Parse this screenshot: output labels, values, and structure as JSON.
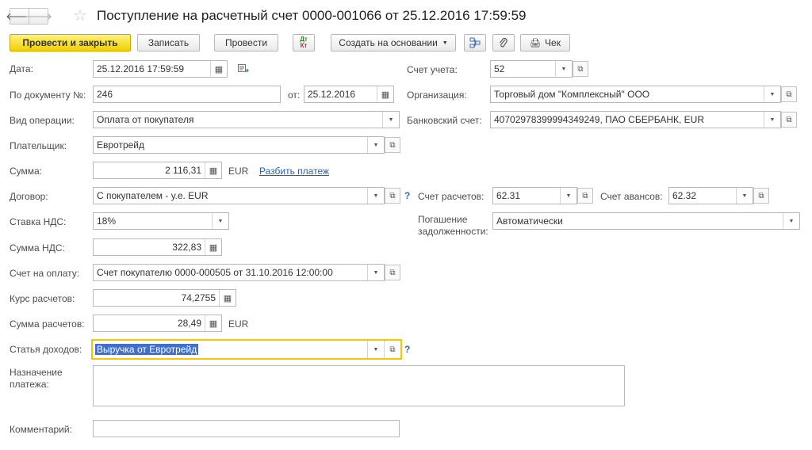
{
  "header": {
    "title": "Поступление на расчетный счет 0000-001066 от 25.12.2016 17:59:59",
    "back_icon": "arrow-left-icon",
    "forward_icon": "arrow-right-icon",
    "favorite_icon": "star-icon"
  },
  "toolbar": {
    "post_close": "Провести и закрыть",
    "save": "Записать",
    "post": "Провести",
    "dtkt_top": "Дт",
    "dtkt_bottom": "Кт",
    "create_based": "Создать на основании",
    "receipt": "Чек"
  },
  "left": {
    "date_label": "Дата:",
    "date_value": "25.12.2016 17:59:59",
    "docnum_label": "По документу №:",
    "docnum_value": "246",
    "docdate_label": "от:",
    "docdate_value": "25.12.2016",
    "optype_label": "Вид операции:",
    "optype_value": "Оплата от покупателя",
    "payer_label": "Плательщик:",
    "payer_value": "Евротрейд",
    "sum_label": "Сумма:",
    "sum_value": "2 116,31",
    "sum_currency": "EUR",
    "split_link": "Разбить платеж",
    "contract_label": "Договор:",
    "contract_value": "С покупателем - у.е. EUR",
    "vatrate_label": "Ставка НДС:",
    "vatrate_value": "18%",
    "vatsum_label": "Сумма НДС:",
    "vatsum_value": "322,83",
    "invoice_label": "Счет на оплату:",
    "invoice_value": "Счет покупателю 0000-000505 от 31.10.2016 12:00:00",
    "rate_label": "Курс расчетов:",
    "rate_value": "74,2755",
    "settle_label": "Сумма расчетов:",
    "settle_value": "28,49",
    "settle_currency": "EUR",
    "income_label": "Статья доходов:",
    "income_value": "Выручка от Евротрейд",
    "purpose_label_1": "Назначение",
    "purpose_label_2": "платежа:",
    "comment_label": "Комментарий:",
    "question": "?"
  },
  "right": {
    "account_label": "Счет учета:",
    "account_value": "52",
    "org_label": "Организация:",
    "org_value": "Торговый дом \"Комплексный\" ООО",
    "bank_label": "Банковский счет:",
    "bank_value": "40702978399994349249, ПАО СБЕРБАНК, EUR",
    "settle_acc_label": "Счет расчетов:",
    "settle_acc_value": "62.31",
    "advance_acc_label": "Счет авансов:",
    "advance_acc_value": "62.32",
    "repay_label_1": "Погашение",
    "repay_label_2": "задолженности:",
    "repay_value": "Автоматически"
  }
}
